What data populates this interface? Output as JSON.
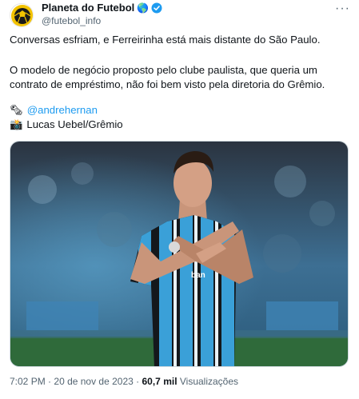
{
  "author": {
    "display_name": "Planeta do Futebol",
    "handle": "@futebol_info",
    "globe_emoji": "🌎",
    "verified_icon": "verified-badge-icon",
    "avatar_icon": "ball-logo-icon"
  },
  "menu": {
    "more_label": "···"
  },
  "tweet": {
    "line1": "Conversas esfriam, e Ferreirinha está mais distante do São Paulo.",
    "line2a": "O modelo de negócio proposto pelo clube paulista, que queria um",
    "line2b": "contrato de empréstimo, não foi bem visto pela diretoria do Grêmio.",
    "credit_writer_emoji": "🗞",
    "credit_writer": "@andrehernan",
    "credit_photo_emoji": "📸",
    "credit_photo": "Lucas Uebel/Grêmio"
  },
  "media": {
    "description_icon": "player-photo",
    "colors": {
      "accent": "#1d9bf0",
      "jersey_blue": "#3aa0d8",
      "jersey_black": "#14181c"
    }
  },
  "footer": {
    "time": "7:02 PM",
    "separator": "·",
    "date": "20 de nov de 2023",
    "views_count": "60,7 mil",
    "views_label": "Visualizações"
  }
}
